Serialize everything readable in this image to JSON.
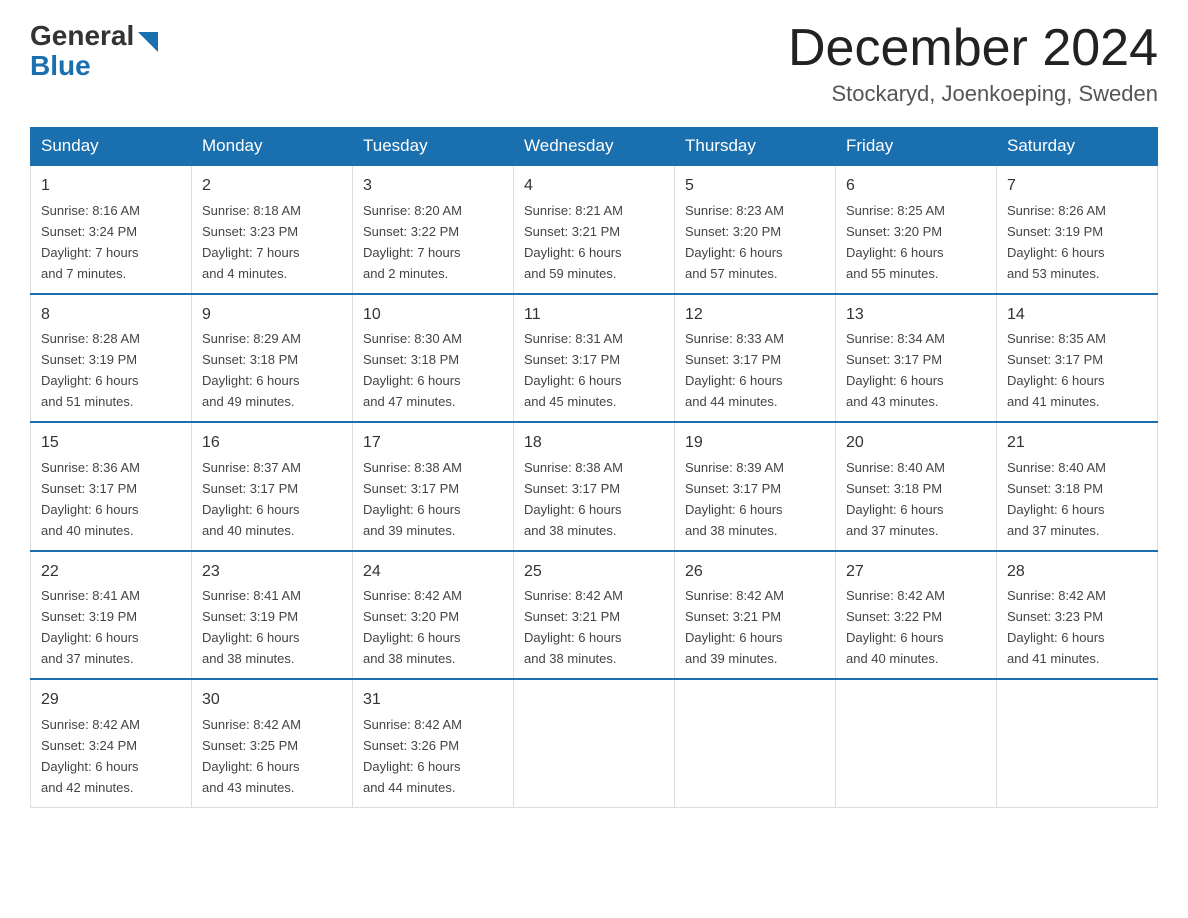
{
  "header": {
    "logo_general": "General",
    "logo_blue": "Blue",
    "month_title": "December 2024",
    "location": "Stockaryd, Joenkoeping, Sweden"
  },
  "days_of_week": [
    "Sunday",
    "Monday",
    "Tuesday",
    "Wednesday",
    "Thursday",
    "Friday",
    "Saturday"
  ],
  "weeks": [
    [
      {
        "day": "1",
        "info": "Sunrise: 8:16 AM\nSunset: 3:24 PM\nDaylight: 7 hours\nand 7 minutes."
      },
      {
        "day": "2",
        "info": "Sunrise: 8:18 AM\nSunset: 3:23 PM\nDaylight: 7 hours\nand 4 minutes."
      },
      {
        "day": "3",
        "info": "Sunrise: 8:20 AM\nSunset: 3:22 PM\nDaylight: 7 hours\nand 2 minutes."
      },
      {
        "day": "4",
        "info": "Sunrise: 8:21 AM\nSunset: 3:21 PM\nDaylight: 6 hours\nand 59 minutes."
      },
      {
        "day": "5",
        "info": "Sunrise: 8:23 AM\nSunset: 3:20 PM\nDaylight: 6 hours\nand 57 minutes."
      },
      {
        "day": "6",
        "info": "Sunrise: 8:25 AM\nSunset: 3:20 PM\nDaylight: 6 hours\nand 55 minutes."
      },
      {
        "day": "7",
        "info": "Sunrise: 8:26 AM\nSunset: 3:19 PM\nDaylight: 6 hours\nand 53 minutes."
      }
    ],
    [
      {
        "day": "8",
        "info": "Sunrise: 8:28 AM\nSunset: 3:19 PM\nDaylight: 6 hours\nand 51 minutes."
      },
      {
        "day": "9",
        "info": "Sunrise: 8:29 AM\nSunset: 3:18 PM\nDaylight: 6 hours\nand 49 minutes."
      },
      {
        "day": "10",
        "info": "Sunrise: 8:30 AM\nSunset: 3:18 PM\nDaylight: 6 hours\nand 47 minutes."
      },
      {
        "day": "11",
        "info": "Sunrise: 8:31 AM\nSunset: 3:17 PM\nDaylight: 6 hours\nand 45 minutes."
      },
      {
        "day": "12",
        "info": "Sunrise: 8:33 AM\nSunset: 3:17 PM\nDaylight: 6 hours\nand 44 minutes."
      },
      {
        "day": "13",
        "info": "Sunrise: 8:34 AM\nSunset: 3:17 PM\nDaylight: 6 hours\nand 43 minutes."
      },
      {
        "day": "14",
        "info": "Sunrise: 8:35 AM\nSunset: 3:17 PM\nDaylight: 6 hours\nand 41 minutes."
      }
    ],
    [
      {
        "day": "15",
        "info": "Sunrise: 8:36 AM\nSunset: 3:17 PM\nDaylight: 6 hours\nand 40 minutes."
      },
      {
        "day": "16",
        "info": "Sunrise: 8:37 AM\nSunset: 3:17 PM\nDaylight: 6 hours\nand 40 minutes."
      },
      {
        "day": "17",
        "info": "Sunrise: 8:38 AM\nSunset: 3:17 PM\nDaylight: 6 hours\nand 39 minutes."
      },
      {
        "day": "18",
        "info": "Sunrise: 8:38 AM\nSunset: 3:17 PM\nDaylight: 6 hours\nand 38 minutes."
      },
      {
        "day": "19",
        "info": "Sunrise: 8:39 AM\nSunset: 3:17 PM\nDaylight: 6 hours\nand 38 minutes."
      },
      {
        "day": "20",
        "info": "Sunrise: 8:40 AM\nSunset: 3:18 PM\nDaylight: 6 hours\nand 37 minutes."
      },
      {
        "day": "21",
        "info": "Sunrise: 8:40 AM\nSunset: 3:18 PM\nDaylight: 6 hours\nand 37 minutes."
      }
    ],
    [
      {
        "day": "22",
        "info": "Sunrise: 8:41 AM\nSunset: 3:19 PM\nDaylight: 6 hours\nand 37 minutes."
      },
      {
        "day": "23",
        "info": "Sunrise: 8:41 AM\nSunset: 3:19 PM\nDaylight: 6 hours\nand 38 minutes."
      },
      {
        "day": "24",
        "info": "Sunrise: 8:42 AM\nSunset: 3:20 PM\nDaylight: 6 hours\nand 38 minutes."
      },
      {
        "day": "25",
        "info": "Sunrise: 8:42 AM\nSunset: 3:21 PM\nDaylight: 6 hours\nand 38 minutes."
      },
      {
        "day": "26",
        "info": "Sunrise: 8:42 AM\nSunset: 3:21 PM\nDaylight: 6 hours\nand 39 minutes."
      },
      {
        "day": "27",
        "info": "Sunrise: 8:42 AM\nSunset: 3:22 PM\nDaylight: 6 hours\nand 40 minutes."
      },
      {
        "day": "28",
        "info": "Sunrise: 8:42 AM\nSunset: 3:23 PM\nDaylight: 6 hours\nand 41 minutes."
      }
    ],
    [
      {
        "day": "29",
        "info": "Sunrise: 8:42 AM\nSunset: 3:24 PM\nDaylight: 6 hours\nand 42 minutes."
      },
      {
        "day": "30",
        "info": "Sunrise: 8:42 AM\nSunset: 3:25 PM\nDaylight: 6 hours\nand 43 minutes."
      },
      {
        "day": "31",
        "info": "Sunrise: 8:42 AM\nSunset: 3:26 PM\nDaylight: 6 hours\nand 44 minutes."
      },
      {
        "day": "",
        "info": ""
      },
      {
        "day": "",
        "info": ""
      },
      {
        "day": "",
        "info": ""
      },
      {
        "day": "",
        "info": ""
      }
    ]
  ]
}
